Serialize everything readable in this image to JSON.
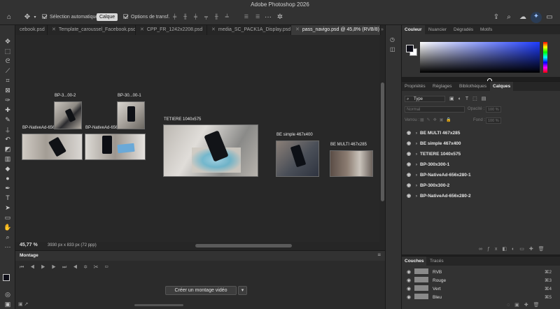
{
  "app": {
    "title": "Adobe Photoshop 2026"
  },
  "options_bar": {
    "auto_select_label": "Sélection automatique :",
    "auto_select_value": "Calque",
    "transform_label": "Options de transf.",
    "icons": [
      "home-icon",
      "move-icon",
      "align-icon",
      "distribute-icon",
      "more-icon",
      "3d-icon",
      "share-icon",
      "search-icon",
      "cloud-icon",
      "discover-icon"
    ]
  },
  "tabs": [
    {
      "label": "cebook.psd",
      "active": false
    },
    {
      "label": "Template_caroussel_Facebook.psd",
      "active": false
    },
    {
      "label": "CPP_FR_1242x2208.psd",
      "active": false
    },
    {
      "label": "media_SC_PACK1A_Display.psd",
      "active": false
    },
    {
      "label": "pass_navigo.psd @ 45,8% (RVB/8)",
      "active": true
    }
  ],
  "canvas": {
    "artboards": [
      {
        "label": "BP-3...00-2"
      },
      {
        "label": "BP-30...00-1"
      },
      {
        "label": "BP-NativeAd-656x280-2"
      },
      {
        "label": "BP-NativeAd-656x280-1"
      },
      {
        "label": "TETIERE 1040x575"
      },
      {
        "label": "BE simple 467x400"
      },
      {
        "label": "BE MULTI 467x285"
      }
    ]
  },
  "status": {
    "zoom": "45,77 %",
    "doc_size": "3930 px x 833 px (72 ppp)"
  },
  "timeline": {
    "title": "Montage",
    "create_button": "Créer un montage vidéo"
  },
  "color_panel": {
    "tabs": [
      "Couleur",
      "Nuancier",
      "Dégradés",
      "Motifs"
    ],
    "foreground": "#0e0e18",
    "background": "#ffffff"
  },
  "layers_panel": {
    "tabs": [
      "Propriétés",
      "Réglages",
      "Bibliothèques",
      "Calques"
    ],
    "filter_value": "Type",
    "blend_mode": "Normal",
    "opacity_label": "Opacité :",
    "opacity_value": "100 %",
    "lock_label": "Verrou :",
    "fill_label": "Fond :",
    "fill_value": "100 %",
    "layers": [
      "BE MULTI 467x285",
      "BE simple 467x400",
      "TETIERE 1040x575",
      "BP-300x300-1",
      "BP-NativeAd-656x280-1",
      "BP-300x300-2",
      "BP-NativeAd-656x280-2"
    ]
  },
  "channels_panel": {
    "tabs": [
      "Couches",
      "Tracés"
    ],
    "channels": [
      {
        "name": "RVB",
        "shortcut": "⌘2"
      },
      {
        "name": "Rouge",
        "shortcut": "⌘3"
      },
      {
        "name": "Vert",
        "shortcut": "⌘4"
      },
      {
        "name": "Bleu",
        "shortcut": "⌘5"
      }
    ]
  }
}
